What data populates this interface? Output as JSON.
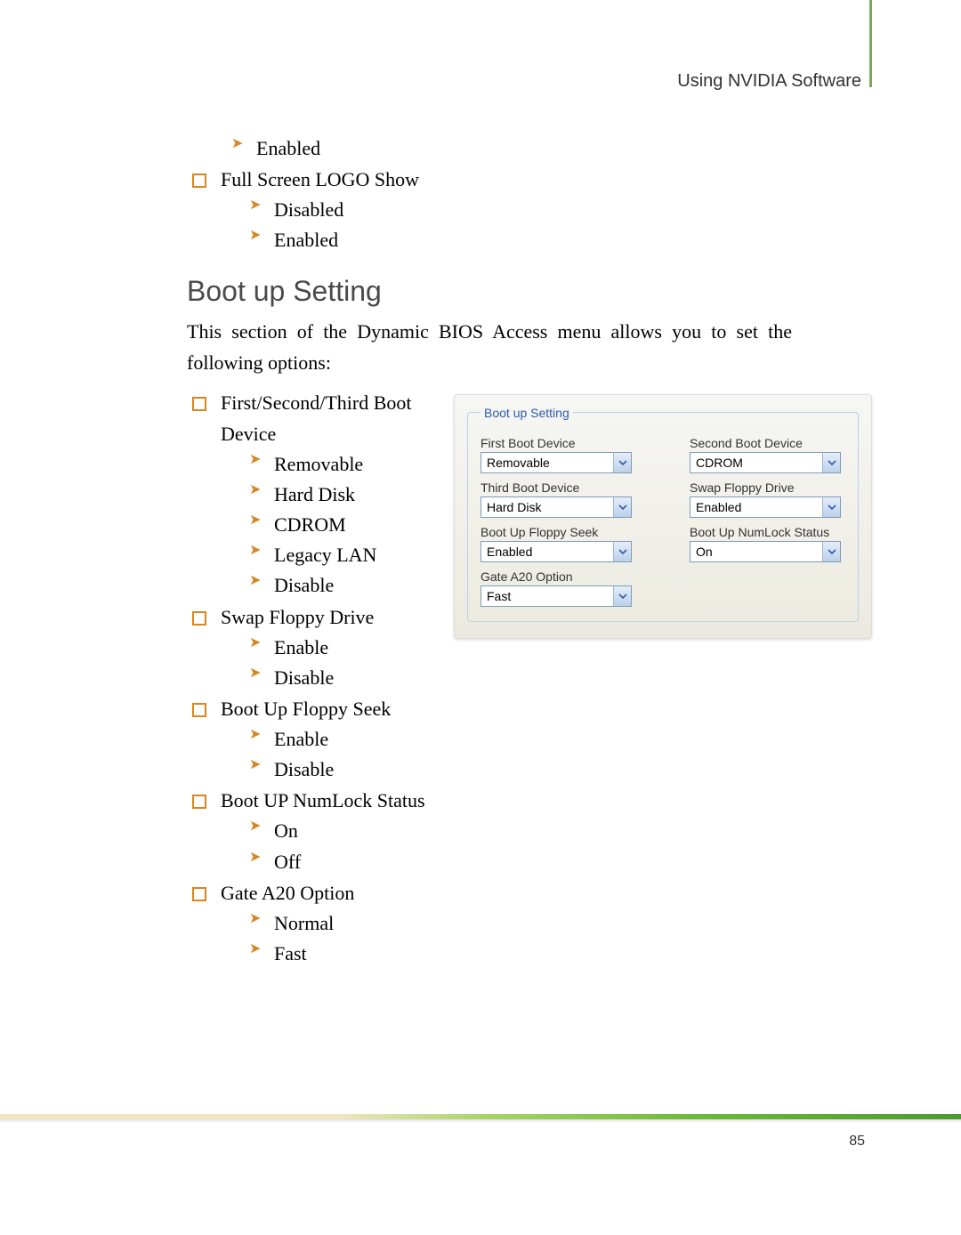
{
  "header": {
    "right_text": "Using NVIDIA Software"
  },
  "intro_top": {
    "pre_items": [
      {
        "options": [
          "Enabled"
        ]
      },
      {
        "label": "Full Screen LOGO Show",
        "options": [
          "Disabled",
          "Enabled"
        ]
      }
    ]
  },
  "section": {
    "title": "Boot up Setting",
    "intro": "This section of the Dynamic BIOS Access menu allows you to set the following options:",
    "items": [
      {
        "label": "First/Second/Third Boot Device",
        "options": [
          "Removable",
          "Hard Disk",
          "CDROM",
          "Legacy LAN",
          "Disable"
        ]
      },
      {
        "label": "Swap Floppy Drive",
        "options": [
          "Enable",
          "Disable"
        ]
      },
      {
        "label": "Boot Up Floppy Seek",
        "options": [
          "Enable",
          "Disable"
        ]
      },
      {
        "label": "Boot UP NumLock Status",
        "options": [
          "On",
          "Off"
        ]
      },
      {
        "label": "Gate A20 Option",
        "options": [
          "Normal",
          "Fast"
        ]
      }
    ]
  },
  "panel": {
    "legend": "Boot up Setting",
    "fields": {
      "first_boot": {
        "label": "First Boot Device",
        "value": "Removable"
      },
      "second_boot": {
        "label": "Second Boot Device",
        "value": "CDROM"
      },
      "third_boot": {
        "label": "Third Boot Device",
        "value": "Hard Disk"
      },
      "swap_floppy": {
        "label": "Swap Floppy Drive",
        "value": "Enabled"
      },
      "floppy_seek": {
        "label": "Boot Up Floppy Seek",
        "value": "Enabled"
      },
      "numlock": {
        "label": "Boot Up NumLock Status",
        "value": "On"
      },
      "gate_a20": {
        "label": "Gate A20 Option",
        "value": "Fast"
      }
    }
  },
  "footer": {
    "page_number": "85"
  }
}
